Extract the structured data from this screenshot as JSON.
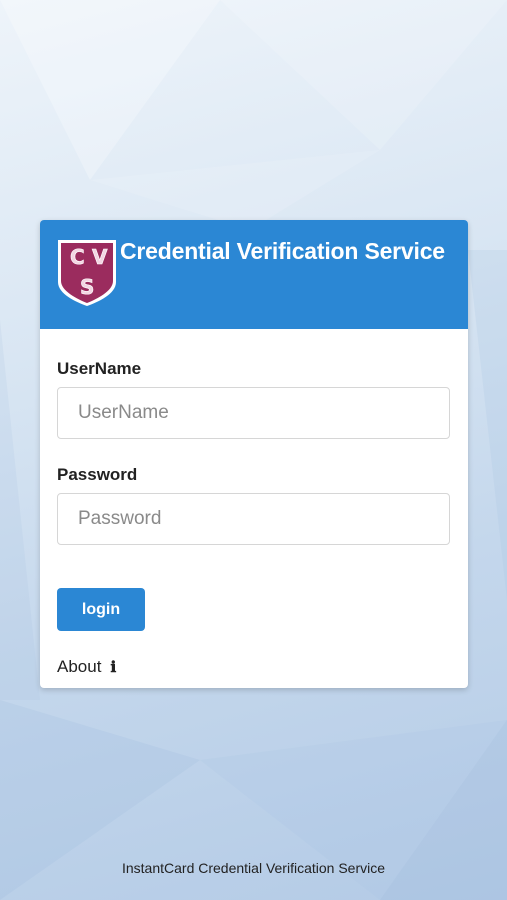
{
  "app": {
    "title": "Credential Verification Service",
    "logo_text": [
      "C",
      "V",
      "S"
    ]
  },
  "form": {
    "username_label": "UserName",
    "username_placeholder": "UserName",
    "username_value": "",
    "password_label": "Password",
    "password_placeholder": "Password",
    "password_value": "",
    "login_label": "login"
  },
  "about": {
    "label": "About",
    "icon": "info-icon"
  },
  "footer": {
    "text": "InstantCard Credential Verification Service"
  },
  "colors": {
    "brand_blue": "#2b87d4",
    "logo_maroon": "#9b2c5e"
  }
}
